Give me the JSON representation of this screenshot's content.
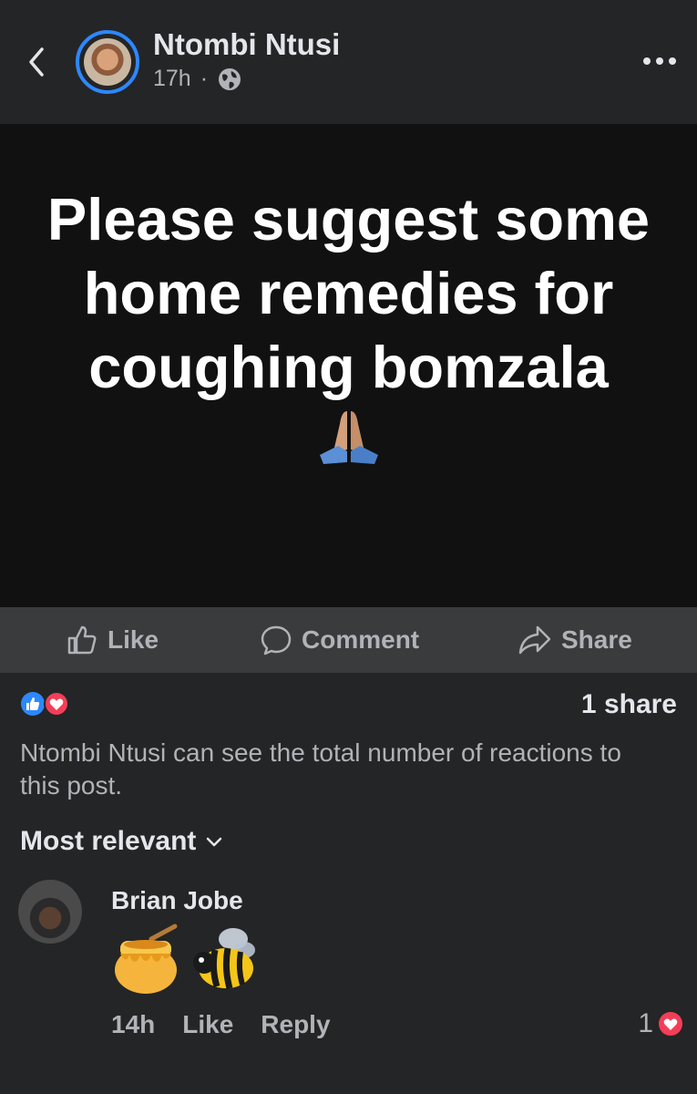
{
  "post": {
    "author": "Ntombi Ntusi",
    "time": "17h",
    "separator": "·",
    "privacy_icon": "globe-icon",
    "text": "Please suggest some home remedies for coughing bomzala",
    "text_emoji_icon": "folded-hands-emoji"
  },
  "actions": {
    "like": "Like",
    "comment": "Comment",
    "share": "Share"
  },
  "reactions": {
    "types": [
      "like-reaction-icon",
      "love-reaction-icon"
    ],
    "share_count": "1 share",
    "privacy_note": "Ntombi Ntusi can see the total number of reactions to this post."
  },
  "comments": {
    "sort_label": "Most relevant",
    "items": [
      {
        "author": "Brian Jobe",
        "content_icons": [
          "honey-pot-emoji",
          "bee-emoji"
        ],
        "time": "14h",
        "like": "Like",
        "reply": "Reply",
        "reaction_count": "1",
        "reaction_icon": "love-reaction-icon"
      }
    ]
  },
  "colors": {
    "background": "#242526",
    "post_background": "#111111",
    "action_bar": "#3a3b3c",
    "accent_blue": "#2d88ff",
    "love_red": "#f33e58",
    "muted_text": "#b0b3b8"
  }
}
